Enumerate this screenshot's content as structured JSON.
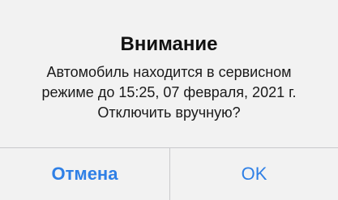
{
  "alert": {
    "title": "Внимание",
    "message_lines": [
      "Автомобиль находится в сервисном",
      "режиме до 15:25, 07 февраля, 2021 г.",
      "Отключить вручную?"
    ],
    "buttons": {
      "cancel_label": "Отмена",
      "ok_label": "OK"
    },
    "accent_color": "#2f80e6"
  }
}
